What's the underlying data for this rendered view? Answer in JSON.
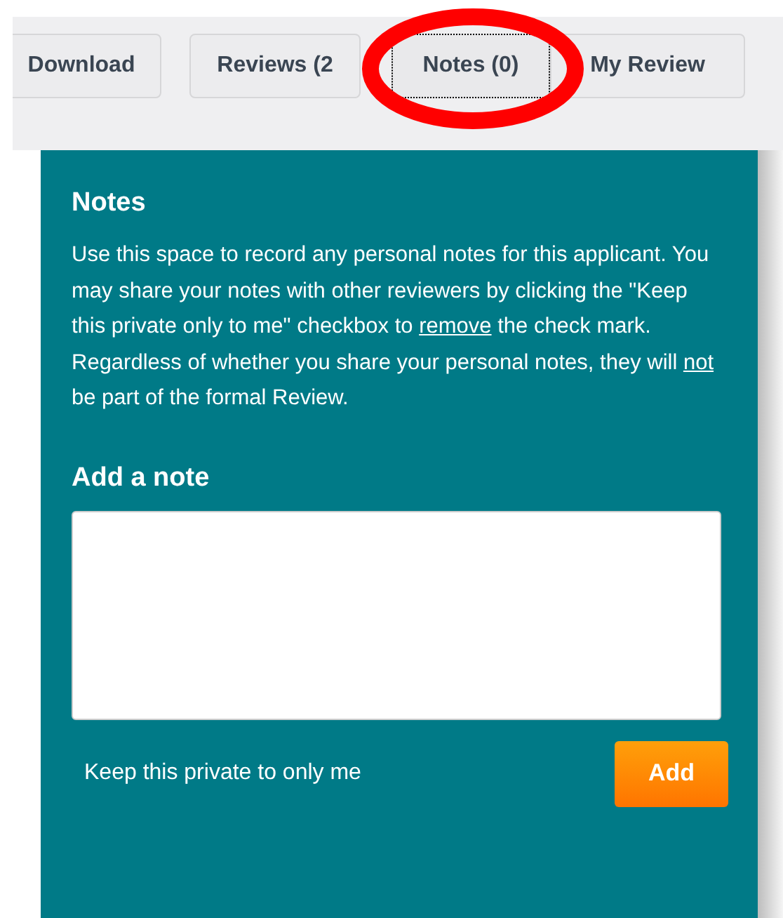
{
  "tabs": [
    {
      "label": "Download",
      "selected": false
    },
    {
      "label": "Reviews (2",
      "selected": false
    },
    {
      "label": "Notes (0)",
      "selected": true
    },
    {
      "label": "My Review",
      "selected": false
    }
  ],
  "annotation": {
    "kind": "ellipse",
    "color": "#ff0000"
  },
  "panel": {
    "title": "Notes",
    "description": [
      {
        "text": "Use this space to record any personal notes for this applicant. You may share your notes with other reviewers by clicking the \"Keep this private only to me\" checkbox to ",
        "underline": false
      },
      {
        "text": "remove",
        "underline": true
      },
      {
        "text": " the check mark. Regardless of whether you share your personal notes, they will ",
        "underline": false
      },
      {
        "text": "not",
        "underline": true
      },
      {
        "text": " be part of the formal Review.",
        "underline": false
      }
    ],
    "add_heading": "Add a note",
    "private_label": "Keep this private to only me",
    "add_button": "Add"
  }
}
